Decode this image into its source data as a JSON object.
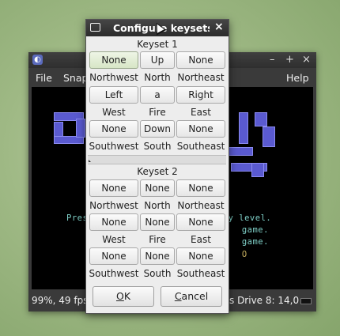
{
  "emulator": {
    "menus": [
      "File",
      "Snap",
      "Help"
    ],
    "controls": [
      "–",
      "+",
      "×"
    ],
    "screen_lines": [
      "Pres                         ty level.",
      "P                            game.",
      "                             game.",
      "                             O"
    ],
    "status_left": "99%, 49 fps",
    "status_right": "s Drive 8: 14,0"
  },
  "dialog": {
    "title": "Configure keysets",
    "close": "×",
    "keyset1_label": "Keyset 1",
    "keyset2_label": "Keyset 2",
    "keyset1": {
      "row1_buttons": [
        "None",
        "Up",
        "None"
      ],
      "row1_labels": [
        "Northwest",
        "North",
        "Northeast"
      ],
      "row2_buttons": [
        "Left",
        "a",
        "Right"
      ],
      "row2_labels": [
        "West",
        "Fire",
        "East"
      ],
      "row3_buttons": [
        "None",
        "Down",
        "None"
      ],
      "row3_labels": [
        "Southwest",
        "South",
        "Southeast"
      ]
    },
    "keyset2": {
      "row1_buttons": [
        "None",
        "None",
        "None"
      ],
      "row1_labels": [
        "Northwest",
        "North",
        "Northeast"
      ],
      "row2_buttons": [
        "None",
        "None",
        "None"
      ],
      "row2_labels": [
        "West",
        "Fire",
        "East"
      ],
      "row3_buttons": [
        "None",
        "None",
        "None"
      ],
      "row3_labels": [
        "Southwest",
        "South",
        "Southeast"
      ]
    },
    "ok_label_mnemonic": "O",
    "ok_label_rest": "K",
    "cancel_label_mnemonic": "C",
    "cancel_label_rest": "ancel"
  }
}
